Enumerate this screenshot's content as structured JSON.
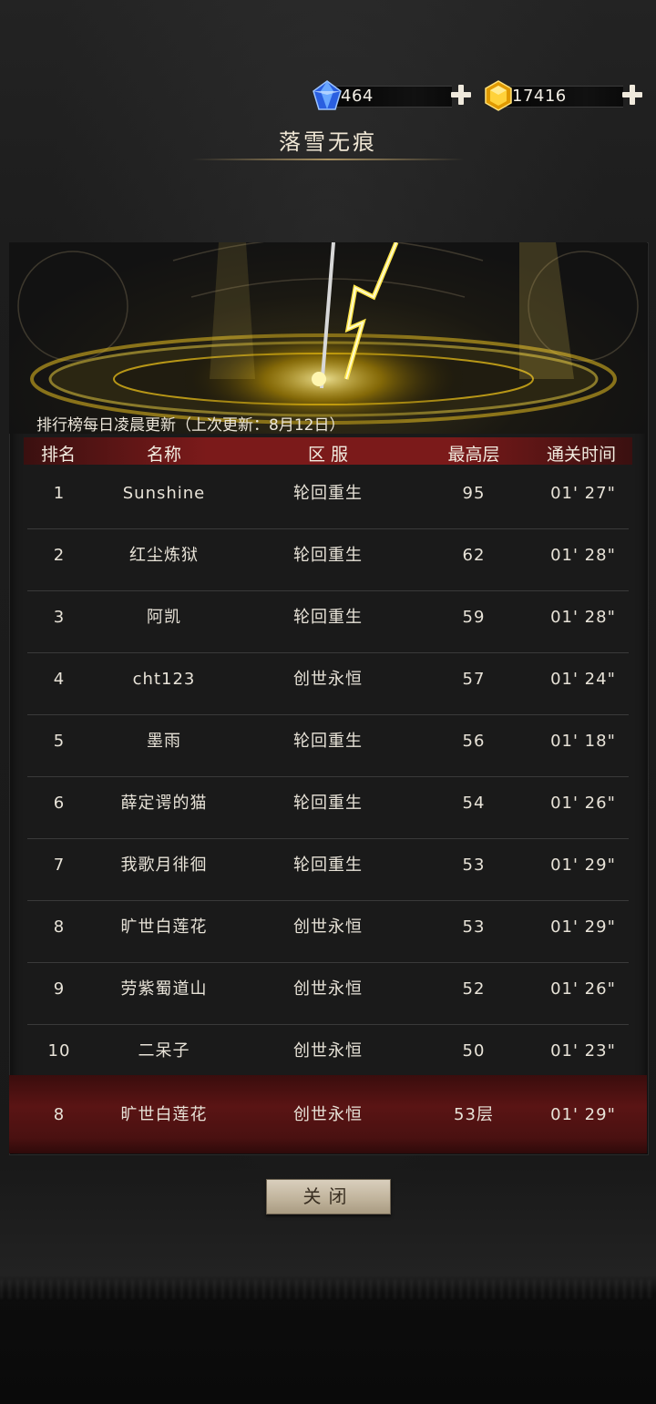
{
  "currency": {
    "gems": {
      "value": "464",
      "icon": "blue-gem-icon"
    },
    "gold": {
      "value": "17416",
      "icon": "gold-gem-icon"
    }
  },
  "title": "落雪无痕",
  "notice": "排行榜每日凌晨更新（上次更新：8月12日）",
  "columns": [
    "排名",
    "名称",
    "区 服",
    "最高层",
    "通关时间"
  ],
  "rows": [
    {
      "rank": "1",
      "name": "Sunshine",
      "server": "轮回重生",
      "floor": "95",
      "time": "01' 27\""
    },
    {
      "rank": "2",
      "name": "红尘炼狱",
      "server": "轮回重生",
      "floor": "62",
      "time": "01' 28\""
    },
    {
      "rank": "3",
      "name": "阿凯",
      "server": "轮回重生",
      "floor": "59",
      "time": "01' 28\""
    },
    {
      "rank": "4",
      "name": "cht123",
      "server": "创世永恒",
      "floor": "57",
      "time": "01' 24\""
    },
    {
      "rank": "5",
      "name": "墨雨",
      "server": "轮回重生",
      "floor": "56",
      "time": "01' 18\""
    },
    {
      "rank": "6",
      "name": "薛定谔的猫",
      "server": "轮回重生",
      "floor": "54",
      "time": "01' 26\""
    },
    {
      "rank": "7",
      "name": "我歌月徘徊",
      "server": "轮回重生",
      "floor": "53",
      "time": "01' 29\""
    },
    {
      "rank": "8",
      "name": "旷世白莲花",
      "server": "创世永恒",
      "floor": "53",
      "time": "01' 29\""
    },
    {
      "rank": "9",
      "name": "劳紫蜀道山",
      "server": "创世永恒",
      "floor": "52",
      "time": "01' 26\""
    },
    {
      "rank": "10",
      "name": "二呆子",
      "server": "创世永恒",
      "floor": "50",
      "time": "01' 23\""
    }
  ],
  "my_row": {
    "rank": "8",
    "name": "旷世白莲花",
    "server": "创世永恒",
    "floor": "53层",
    "time": "01' 29\""
  },
  "close_label": "关闭",
  "colors": {
    "header_red": "#7b1a1a",
    "my_row_red": "#5a1414",
    "gold": "#f5c400",
    "gem_blue": "#3a7bff"
  }
}
